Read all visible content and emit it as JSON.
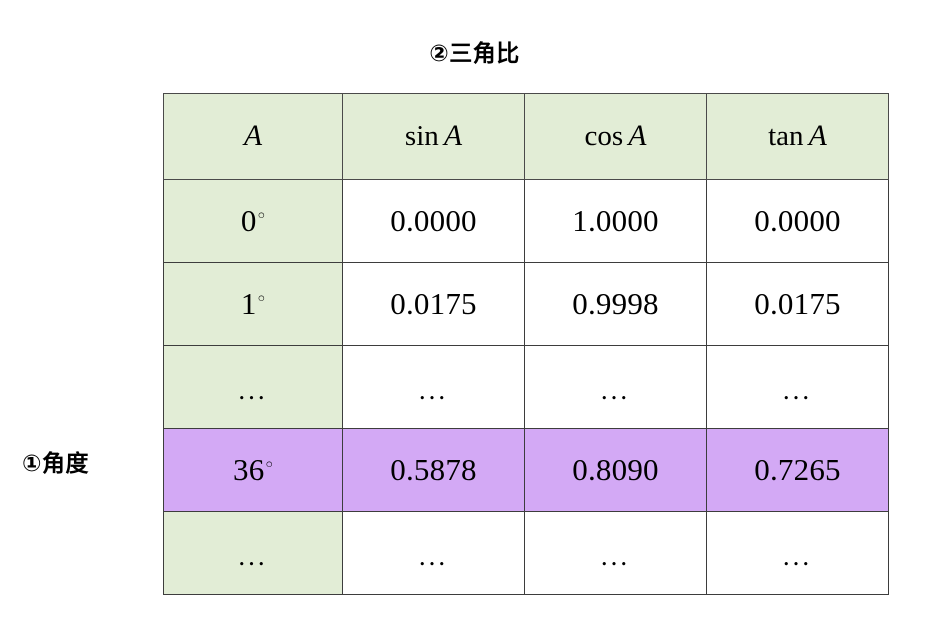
{
  "figure": {
    "title": "②三角比",
    "left_label": "①角度"
  },
  "colors": {
    "header_fill": "#E2EDD6",
    "angle_column_fill": "#E2EDD6",
    "highlight_fill": "#D3A9F5",
    "cell_fill": "#FFFFFF",
    "border": "#3D3D3D",
    "text": "#000000"
  },
  "table": {
    "headers": [
      {
        "prefix": "",
        "variable": "A"
      },
      {
        "prefix": "sin",
        "variable": "A"
      },
      {
        "prefix": "cos",
        "variable": "A"
      },
      {
        "prefix": "tan",
        "variable": "A"
      }
    ],
    "header_plain": [
      "A",
      "sin A",
      "cos A",
      "tan A"
    ],
    "rows": [
      {
        "highlight": false,
        "angle": "0",
        "angle_display": "0°",
        "sin": "0.0000",
        "cos": "1.0000",
        "tan": "0.0000"
      },
      {
        "highlight": false,
        "angle": "1",
        "angle_display": "1°",
        "sin": "0.0175",
        "cos": "0.9998",
        "tan": "0.0175"
      },
      {
        "highlight": false,
        "angle": "...",
        "angle_display": "...",
        "sin": "...",
        "cos": "...",
        "tan": "..."
      },
      {
        "highlight": true,
        "angle": "36",
        "angle_display": "36°",
        "sin": "0.5878",
        "cos": "0.8090",
        "tan": "0.7265"
      },
      {
        "highlight": false,
        "angle": "...",
        "angle_display": "...",
        "sin": "...",
        "cos": "...",
        "tan": "..."
      }
    ]
  },
  "chart_data": {
    "type": "table",
    "title": "②三角比",
    "row_group_label": "①角度",
    "columns": [
      "A",
      "sin A",
      "cos A",
      "tan A"
    ],
    "rows": [
      [
        "0°",
        "0.0000",
        "1.0000",
        "0.0000"
      ],
      [
        "1°",
        "0.0175",
        "0.9998",
        "0.0175"
      ],
      [
        "...",
        "...",
        "...",
        "..."
      ],
      [
        "36°",
        "0.5878",
        "0.8090",
        "0.7265"
      ],
      [
        "...",
        "...",
        "...",
        "..."
      ]
    ],
    "highlighted_row_index": 3,
    "notes": "Trigonometric ratio table; first column (angle A) shaded green, row for 36° shaded purple."
  }
}
